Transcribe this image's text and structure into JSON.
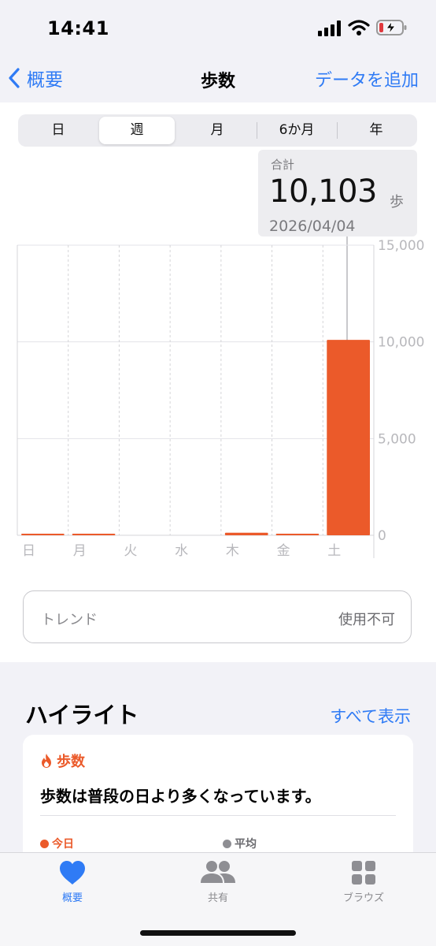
{
  "status_bar": {
    "time": "14:41"
  },
  "nav": {
    "back_label": "概要",
    "title": "歩数",
    "add_label": "データを追加"
  },
  "segments": {
    "items": [
      "日",
      "週",
      "月",
      "6か月",
      "年"
    ],
    "selected": "週"
  },
  "tooltip": {
    "label": "合計",
    "value": "10,103",
    "unit": "歩",
    "date": "2026/04/04"
  },
  "chart_data": {
    "type": "bar",
    "categories": [
      "日",
      "月",
      "火",
      "水",
      "木",
      "金",
      "土"
    ],
    "values": [
      30,
      40,
      0,
      0,
      130,
      80,
      10103
    ],
    "y_ticks": [
      0,
      5000,
      10000,
      15000
    ],
    "y_tick_labels": [
      "0",
      "5,000",
      "10,000",
      "15,000"
    ],
    "ylim": [
      0,
      15000
    ],
    "selected_index": 6,
    "bar_color": "#eb5a2a"
  },
  "trend": {
    "label": "トレンド",
    "value": "使用不可"
  },
  "highlights": {
    "title": "ハイライト",
    "show_all": "すべて表示",
    "card": {
      "category": "歩数",
      "text": "歩数は普段の日より多くなっています。",
      "legend_today": "今日",
      "legend_avg": "平均"
    }
  },
  "tabs": [
    {
      "label": "概要",
      "icon": "heart-icon",
      "active": true
    },
    {
      "label": "共有",
      "icon": "people-icon",
      "active": false
    },
    {
      "label": "ブラウズ",
      "icon": "grid-icon",
      "active": false
    }
  ],
  "colors": {
    "accent": "#2f7bf5",
    "steps": "#eb5a2a"
  }
}
